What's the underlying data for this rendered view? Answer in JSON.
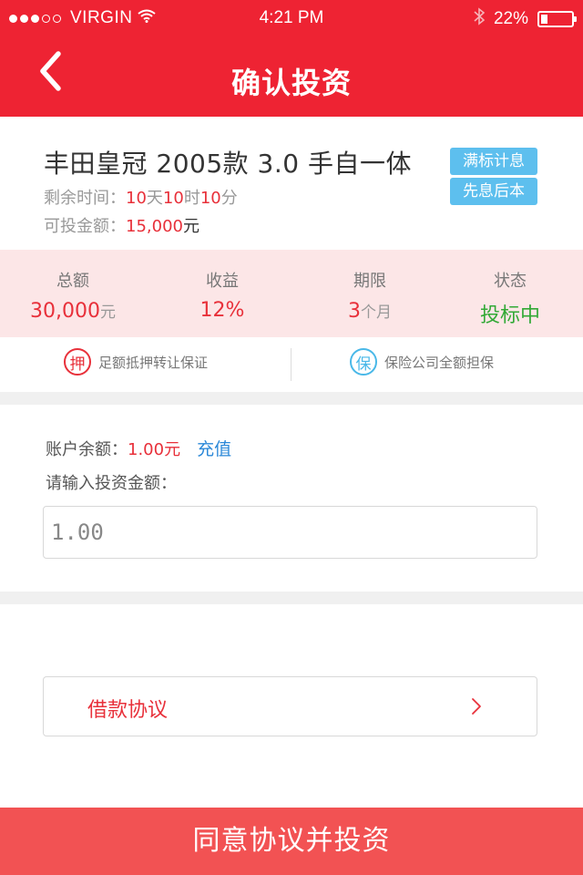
{
  "status_bar": {
    "carrier": "VIRGIN",
    "time": "4:21 PM",
    "battery_text": "22%",
    "battery_level": 0.22
  },
  "nav": {
    "title": "确认投资",
    "back_icon": "chevron-left-icon"
  },
  "product": {
    "title": "丰田皇冠 2005款 3.0 手自一体",
    "time_label": "剩余时间：",
    "time_days": "10",
    "time_day_unit": "天",
    "time_hours": "10",
    "time_hour_unit": "时",
    "time_minutes": "10",
    "time_minute_unit": "分",
    "investable_label": "可投金额：",
    "investable_amount": "15,000",
    "investable_unit": "元",
    "tags": [
      "满标计息",
      "先息后本"
    ]
  },
  "stats": [
    {
      "label": "总额",
      "value": "30,000",
      "unit": "元"
    },
    {
      "label": "收益",
      "value": "12%",
      "unit": ""
    },
    {
      "label": "期限",
      "value": "3",
      "unit": "个月"
    },
    {
      "label": "状态",
      "value": "投标中",
      "unit": ""
    }
  ],
  "guarantees": [
    {
      "icon_char": "押",
      "text": "足额抵押转让保证"
    },
    {
      "icon_char": "保",
      "text": "保险公司全额担保"
    }
  ],
  "account": {
    "balance_label": "账户余额：",
    "balance_amount": "1.00元",
    "recharge_label": "充值",
    "prompt": "请输入投资金额：",
    "input_value": "1.00"
  },
  "agreement": {
    "label": "借款协议"
  },
  "submit": {
    "label": "同意协议并投资"
  },
  "colors": {
    "brand_red": "#ee2333",
    "accent_red": "#e8303a",
    "button_red": "#f25253",
    "tag_blue": "#5dbfee",
    "link_blue": "#2b88d8",
    "status_green": "#32a936"
  }
}
